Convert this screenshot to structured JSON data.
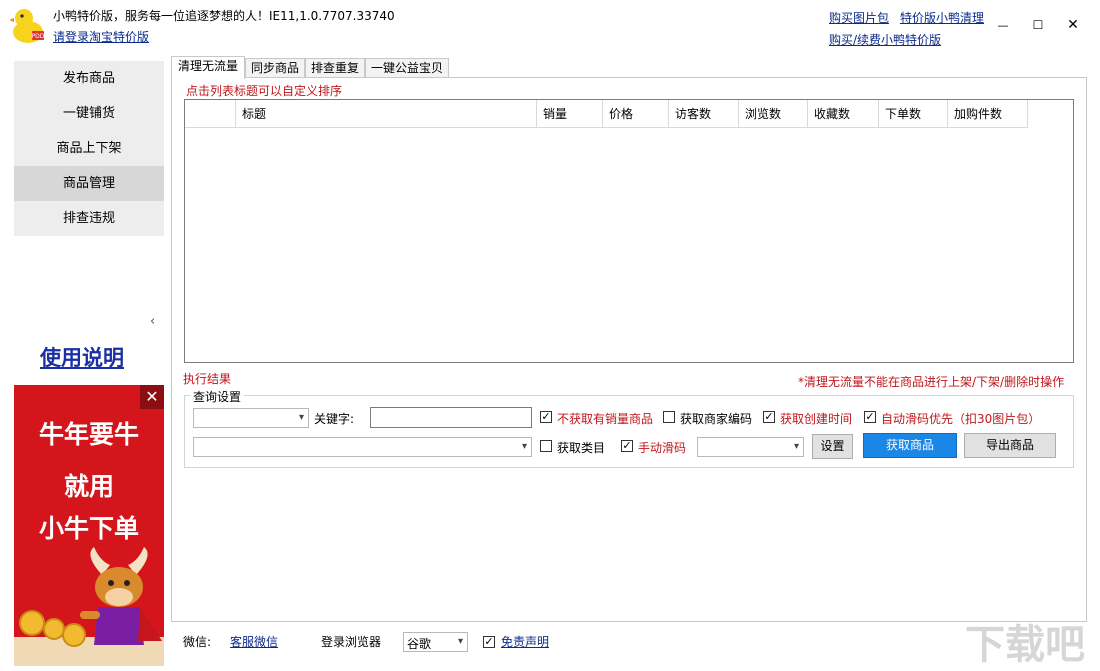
{
  "app": {
    "title": "小鸭特价版，服务每一位追逐梦想的人！IE11,1.0.7707.33740",
    "login_link": "请登录淘宝特价版",
    "top_links": [
      "购买图片包",
      "特价版小鸭清理",
      "购买/续费小鸭特价版"
    ]
  },
  "window_controls": {
    "minimize": "—",
    "maximize": "☐",
    "close": "✕"
  },
  "sidebar": {
    "items": [
      {
        "label": "发布商品",
        "active": false
      },
      {
        "label": "一键铺货",
        "active": false
      },
      {
        "label": "商品上下架",
        "active": false
      },
      {
        "label": "商品管理",
        "active": true
      },
      {
        "label": "排查违规",
        "active": false
      }
    ],
    "collapse_glyph": "‹",
    "usage_link": "使用说明"
  },
  "ad": {
    "lines": [
      "牛年要牛",
      "就用",
      "小牛下单"
    ],
    "close_glyph": "✕",
    "colors": {
      "background": "#d4161c",
      "text": "#ffffff",
      "gold": "#f3b92f"
    }
  },
  "tabs": [
    {
      "label": "清理无流量",
      "active": true
    },
    {
      "label": "同步商品",
      "active": false
    },
    {
      "label": "排查重复",
      "active": false
    },
    {
      "label": "一键公益宝贝",
      "active": false
    }
  ],
  "main": {
    "sort_hint": "点击列表标题可以自定义排序",
    "table": {
      "columns": [
        "",
        "标题",
        "销量",
        "价格",
        "访客数",
        "浏览数",
        "收藏数",
        "下单数",
        "加购件数"
      ],
      "rows": []
    },
    "exec_result_label": "执行结果",
    "warning_note": "*清理无流量不能在商品进行上架/下架/删除时操作"
  },
  "query": {
    "legend": "查询设置",
    "keyword_label": "关键字:",
    "keyword_value": "",
    "checkboxes": [
      {
        "label": "不获取有销量商品",
        "checked": true,
        "red": true
      },
      {
        "label": "获取商家编码",
        "checked": false,
        "red": false
      },
      {
        "label": "获取创建时间",
        "checked": true,
        "red": true
      },
      {
        "label": "自动滑码优先（扣30图片包）",
        "checked": true,
        "red": true
      },
      {
        "label": "获取类目",
        "checked": false,
        "red": false
      },
      {
        "label": "手动滑码",
        "checked": true,
        "red": true
      }
    ],
    "settings_button": "设置",
    "fetch_button": "获取商品",
    "export_button": "导出商品",
    "check_glyph": "✓",
    "dropdown_arrow": "▾"
  },
  "footer": {
    "wechat_label": "微信:",
    "wechat_link": "客服微信",
    "browser_label": "登录浏览器",
    "browser_value": "谷歌",
    "disclaimer_checked": true,
    "disclaimer_link": "免责声明"
  },
  "watermark": "下载吧"
}
